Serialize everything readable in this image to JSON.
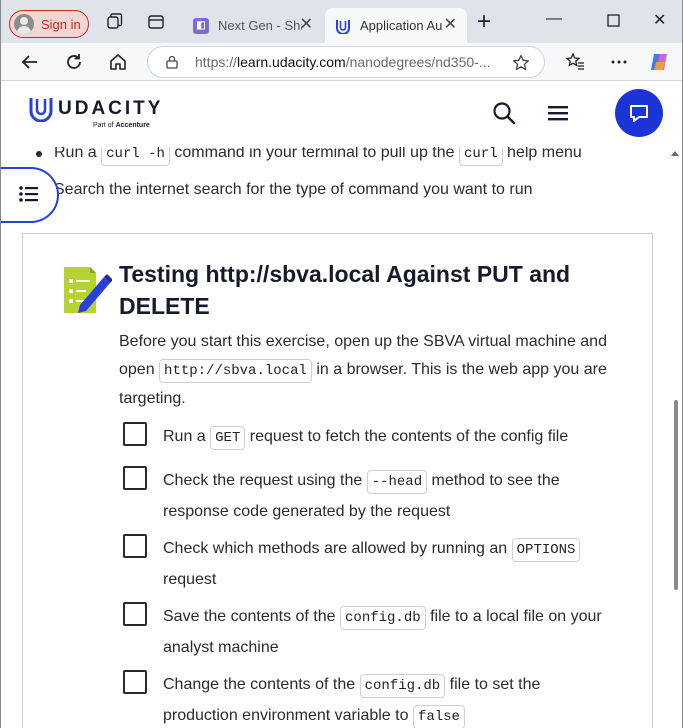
{
  "browser": {
    "signin_label": "Sign in",
    "tabs": [
      {
        "title": "Next Gen - Sha",
        "active": false
      },
      {
        "title": "Application Au",
        "active": true
      }
    ],
    "url_prefix": "https://",
    "url_host": "learn.udacity.com",
    "url_path": "/nanodegrees/nd350-..."
  },
  "site": {
    "logo_text": "UDACITY",
    "logo_sub_prefix": "Part of ",
    "logo_sub_brand": "Accenture"
  },
  "content": {
    "bullets": [
      {
        "pre": "Run a ",
        "code": "curl -h",
        "mid": " command in your terminal to pull up the ",
        "code2": "curl",
        "post": " help menu"
      },
      {
        "text": "Search the internet search for the type of command you want to run"
      }
    ],
    "card": {
      "title": "Testing http://sbva.local Against PUT and DELETE",
      "desc_pre": "Before you start this exercise, open up the SBVA virtual machine and open ",
      "desc_code": "http://sbva.local",
      "desc_post": " in a browser. This is the web app you are targeting.",
      "tasks": [
        {
          "pre": "Run a ",
          "code": "GET",
          "post": " request to fetch the contents of the config file"
        },
        {
          "pre": "Check the request using the ",
          "code": "--head",
          "post": " method to see the response code generated by the request"
        },
        {
          "pre": "Check which methods are allowed by running an ",
          "code": "OPTIONS",
          "post": " request"
        },
        {
          "pre": "Save the contents of the ",
          "code": "config.db",
          "post": " file to a local file on your analyst machine"
        },
        {
          "pre": "Change the contents of the ",
          "code": "config.db",
          "post": " file to set the production environment variable to ",
          "code2": "false"
        }
      ]
    }
  }
}
